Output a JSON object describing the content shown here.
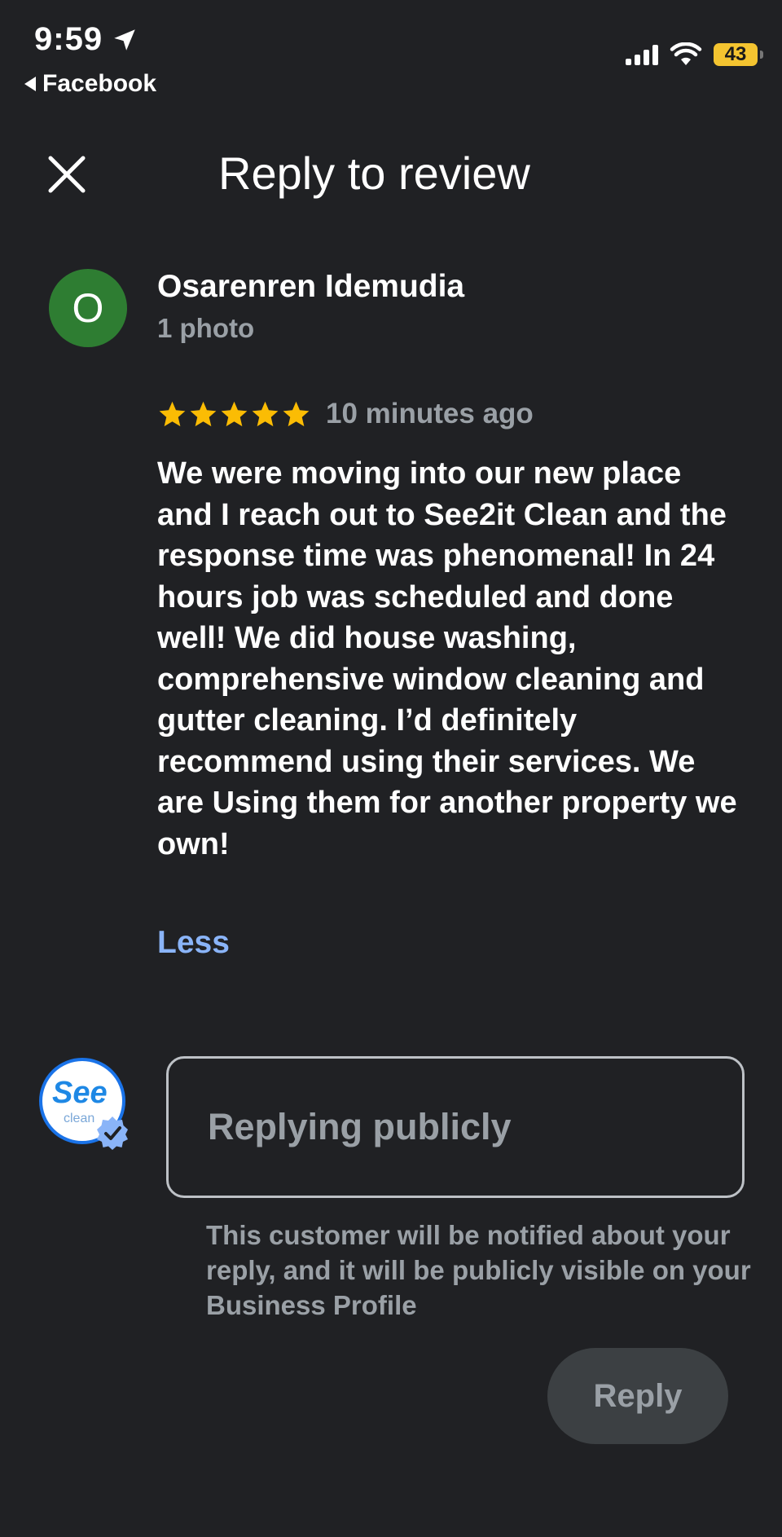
{
  "status_bar": {
    "time": "9:59",
    "back_app": "Facebook",
    "battery": "43"
  },
  "header": {
    "title": "Reply to review",
    "close_icon": "close-icon"
  },
  "review": {
    "avatar_letter": "O",
    "reviewer_name": "Osarenren Idemudia",
    "reviewer_meta": "1 photo",
    "rating": 5,
    "time_ago": "10 minutes ago",
    "text": "We were moving into our new place and I reach out to See2it Clean and the response time was phenomenal! In 24 hours job was scheduled and done well! We did house washing, comprehensive window cleaning and gutter cleaning. I’d definitely recommend using their services. We are Using them for another property we own!",
    "less_label": "Less"
  },
  "reply": {
    "placeholder": "Replying publicly",
    "notice": "This customer will be notified about your reply, and it will be publicly visible on your Business Profile",
    "button_label": "Reply",
    "business_logo": "See2it clean"
  },
  "colors": {
    "background": "#202124",
    "accent_link": "#8ab4f8",
    "star": "#fbbc04",
    "avatar": "#2e7d32"
  }
}
